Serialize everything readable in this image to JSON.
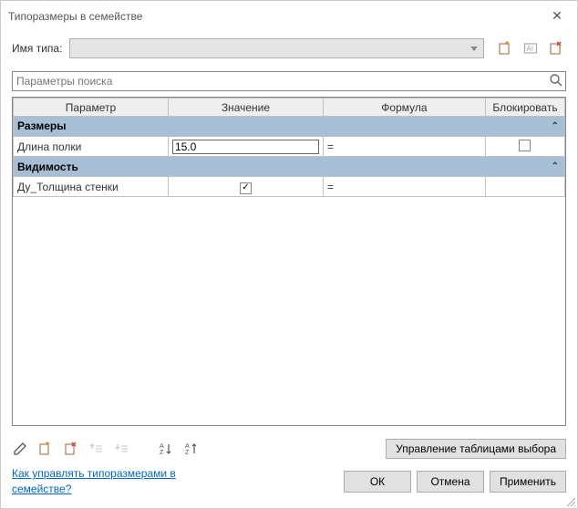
{
  "titlebar": {
    "title": "Типоразмеры в семействе"
  },
  "typeRow": {
    "label": "Имя типа:"
  },
  "search": {
    "placeholder": "Параметры поиска"
  },
  "columns": {
    "param": "Параметр",
    "value": "Значение",
    "formula": "Формула",
    "lock": "Блокировать"
  },
  "groups": {
    "sizes": "Размеры",
    "visibility": "Видимость"
  },
  "rows": {
    "shelfLength": {
      "name": "Длина полки",
      "value": "15.0",
      "formula": "=",
      "lockChecked": false
    },
    "wallThickness": {
      "name": "Ду_Толщина стенки",
      "checked": true,
      "formula": "="
    }
  },
  "toolbar": {
    "manage": "Управление таблицами выбора"
  },
  "footer": {
    "helpLink": "Как управлять типоразмерами в семействе?",
    "ok": "ОК",
    "cancel": "Отмена",
    "apply": "Применить"
  }
}
